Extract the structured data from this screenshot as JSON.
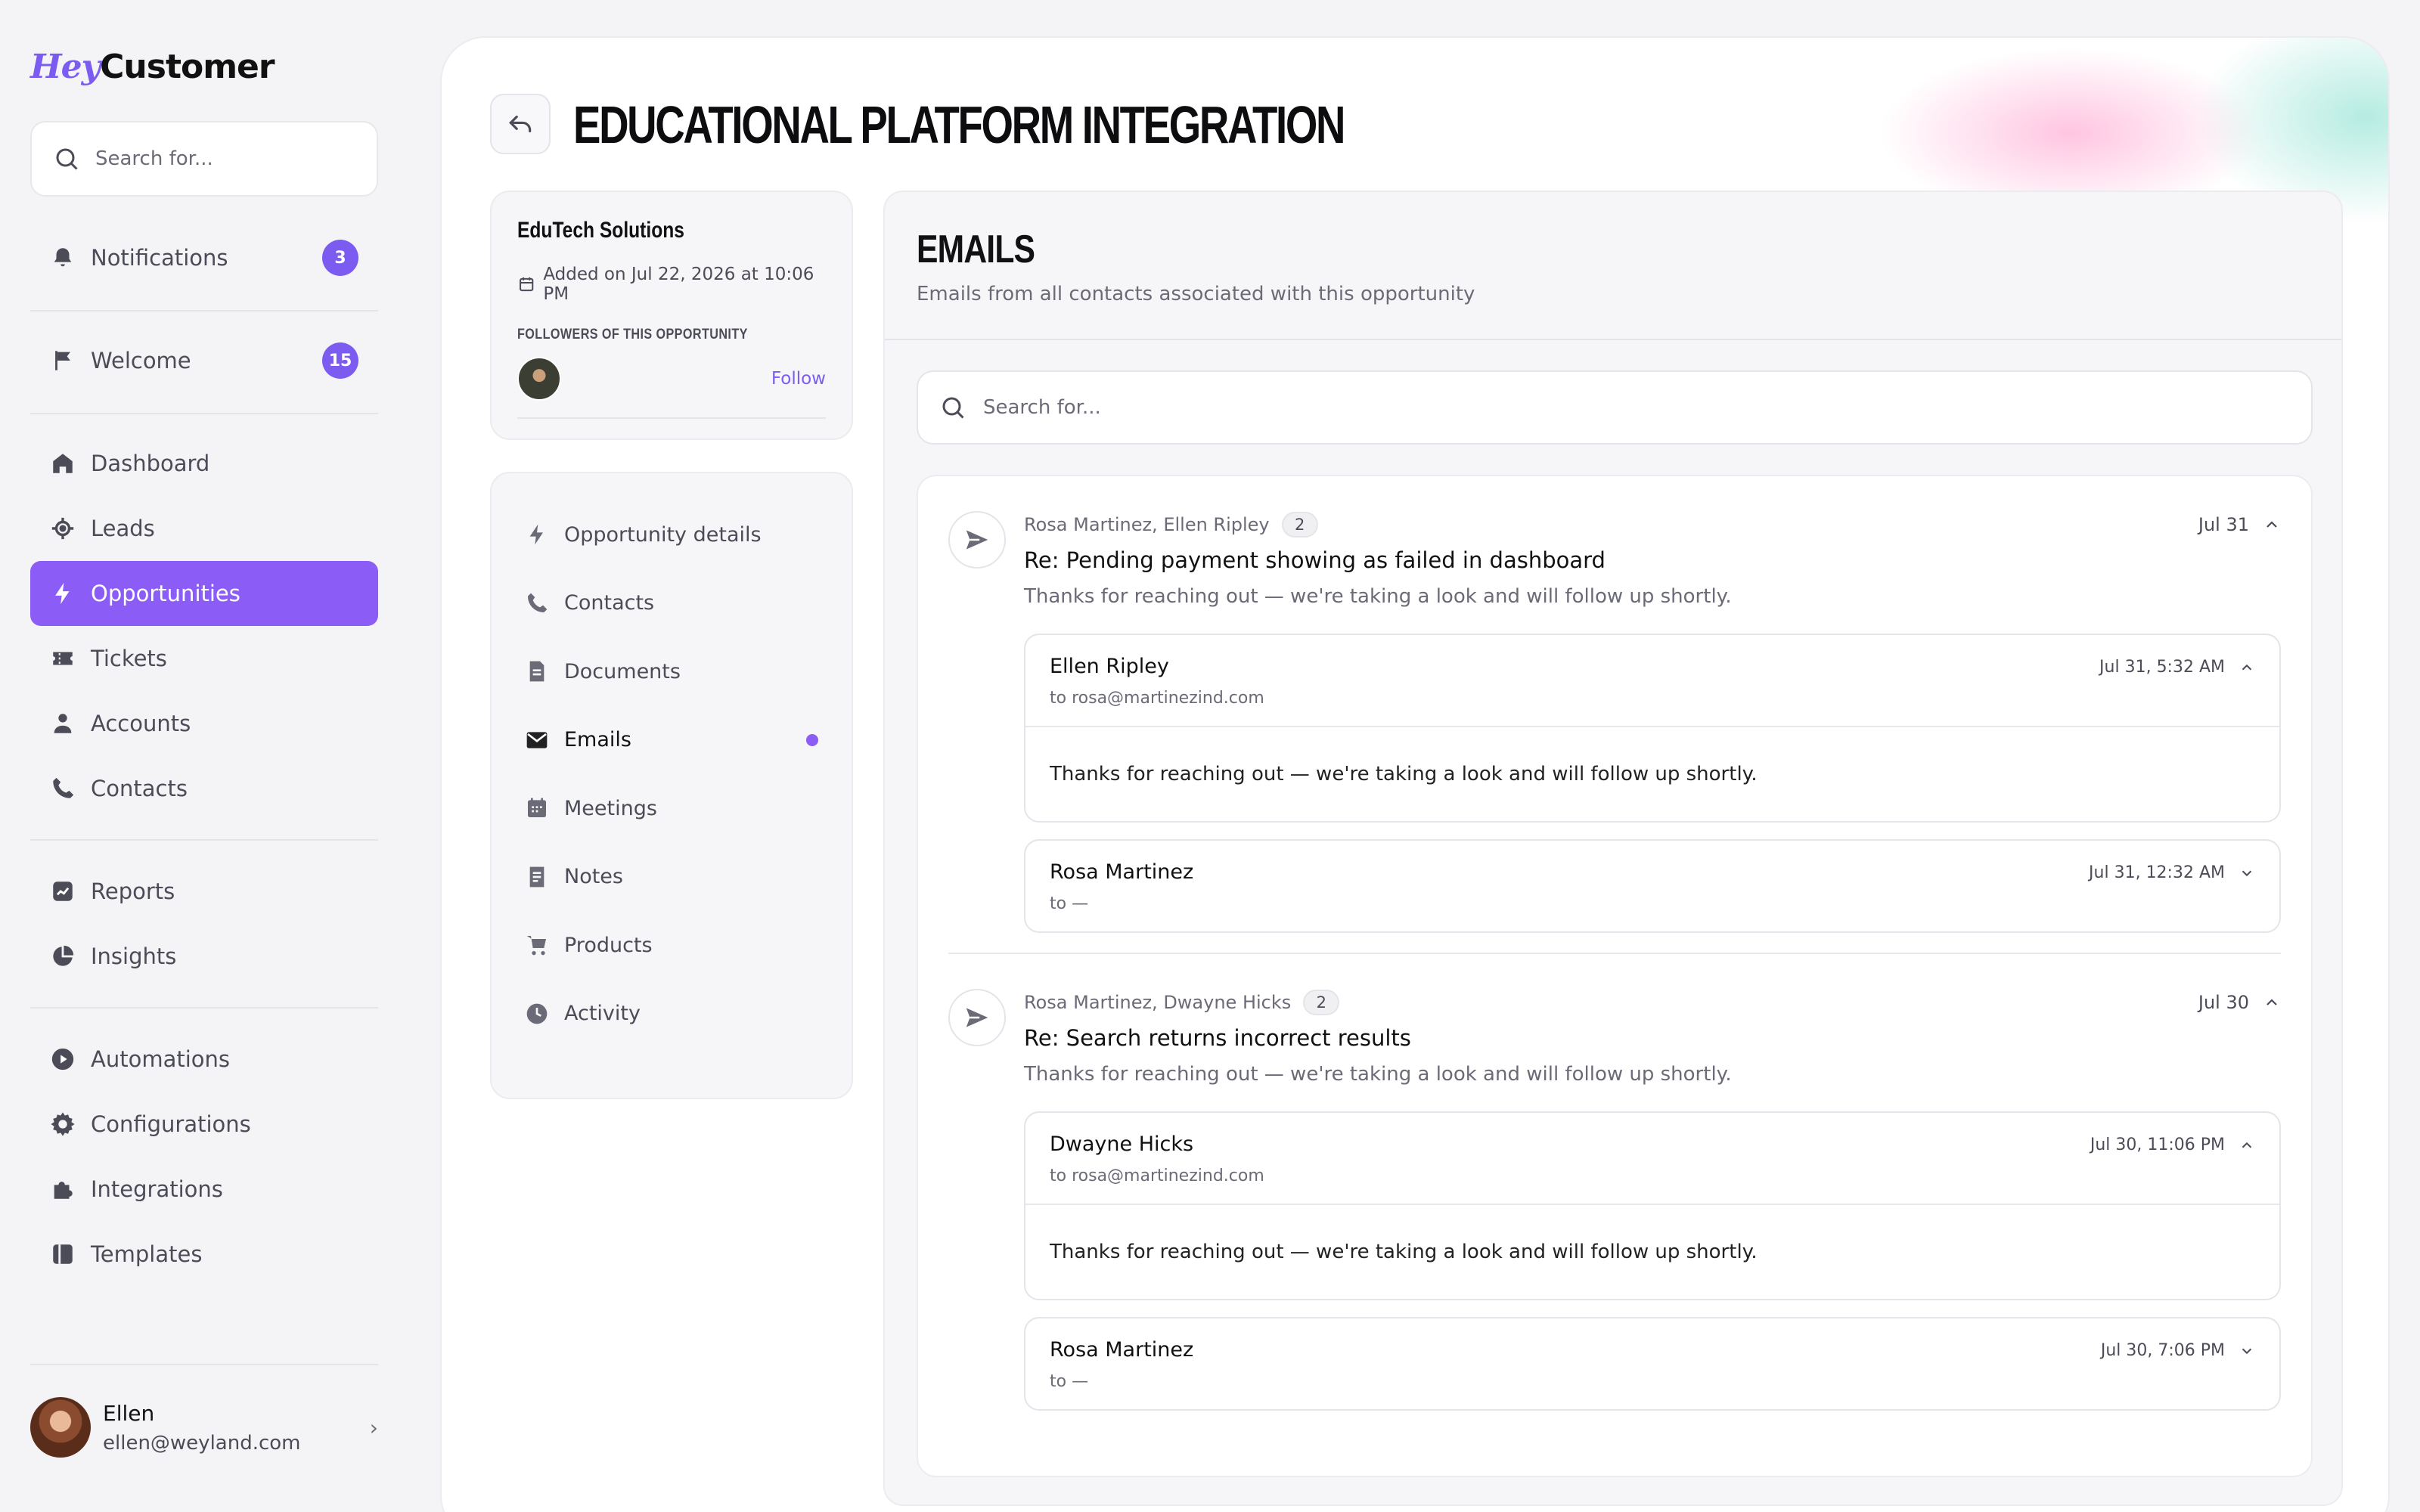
{
  "app": {
    "logo_hey": "Hey",
    "logo_customer": "Customer"
  },
  "sidebar": {
    "search_placeholder": "Search for...",
    "notifications": {
      "label": "Notifications",
      "badge": "3"
    },
    "welcome": {
      "label": "Welcome",
      "badge": "15"
    },
    "items": [
      {
        "label": "Dashboard",
        "icon": "home-icon"
      },
      {
        "label": "Leads",
        "icon": "target-icon"
      },
      {
        "label": "Opportunities",
        "icon": "bolt-icon",
        "active": true
      },
      {
        "label": "Tickets",
        "icon": "ticket-icon"
      },
      {
        "label": "Accounts",
        "icon": "user-icon"
      },
      {
        "label": "Contacts",
        "icon": "phone-icon"
      },
      {
        "label": "Reports",
        "icon": "chart-icon"
      },
      {
        "label": "Insights",
        "icon": "pie-icon"
      },
      {
        "label": "Automations",
        "icon": "play-icon"
      },
      {
        "label": "Configurations",
        "icon": "gear-icon"
      },
      {
        "label": "Integrations",
        "icon": "puzzle-icon"
      },
      {
        "label": "Templates",
        "icon": "template-icon"
      }
    ],
    "user": {
      "name": "Ellen",
      "email": "ellen@weyland.com"
    }
  },
  "page": {
    "title": "EDUCATIONAL PLATFORM INTEGRATION",
    "company": {
      "name": "EduTech Solutions",
      "added": "Added on Jul 22, 2026 at 10:06 PM",
      "followers_label": "FOLLOWERS OF THIS OPPORTUNITY",
      "follow_label": "Follow"
    },
    "subnav": [
      {
        "label": "Opportunity details",
        "icon": "bolt-icon"
      },
      {
        "label": "Contacts",
        "icon": "phone-icon"
      },
      {
        "label": "Documents",
        "icon": "document-icon"
      },
      {
        "label": "Emails",
        "icon": "mail-icon",
        "active": true
      },
      {
        "label": "Meetings",
        "icon": "calendar-icon"
      },
      {
        "label": "Notes",
        "icon": "note-icon"
      },
      {
        "label": "Products",
        "icon": "cart-icon"
      },
      {
        "label": "Activity",
        "icon": "clock-icon"
      }
    ]
  },
  "emails": {
    "title": "EMAILS",
    "subtitle": "Emails from all contacts associated with this opportunity",
    "search_placeholder": "Search for...",
    "threads": [
      {
        "participants": "Rosa Martinez, Ellen Ripley",
        "count": "2",
        "date": "Jul 31",
        "subject": "Re: Pending payment showing as failed in dashboard",
        "preview": "Thanks for reaching out — we're taking a look and will follow up shortly.",
        "messages": [
          {
            "from": "Ellen Ripley",
            "to": "to rosa@martinezind.com",
            "time": "Jul 31, 5:32 AM",
            "expanded": true,
            "body": "Thanks for reaching out — we're taking a look and will follow up shortly."
          },
          {
            "from": "Rosa Martinez",
            "to": "to —",
            "time": "Jul 31, 12:32 AM",
            "expanded": false
          }
        ]
      },
      {
        "participants": "Rosa Martinez, Dwayne Hicks",
        "count": "2",
        "date": "Jul 30",
        "subject": "Re: Search returns incorrect results",
        "preview": "Thanks for reaching out — we're taking a look and will follow up shortly.",
        "messages": [
          {
            "from": "Dwayne Hicks",
            "to": "to rosa@martinezind.com",
            "time": "Jul 30, 11:06 PM",
            "expanded": true,
            "body": "Thanks for reaching out — we're taking a look and will follow up shortly."
          },
          {
            "from": "Rosa Martinez",
            "to": "to —",
            "time": "Jul 30, 7:06 PM",
            "expanded": false
          }
        ]
      }
    ]
  },
  "colors": {
    "accent": "#8b5cf6",
    "badge": "#7c5cf0"
  }
}
